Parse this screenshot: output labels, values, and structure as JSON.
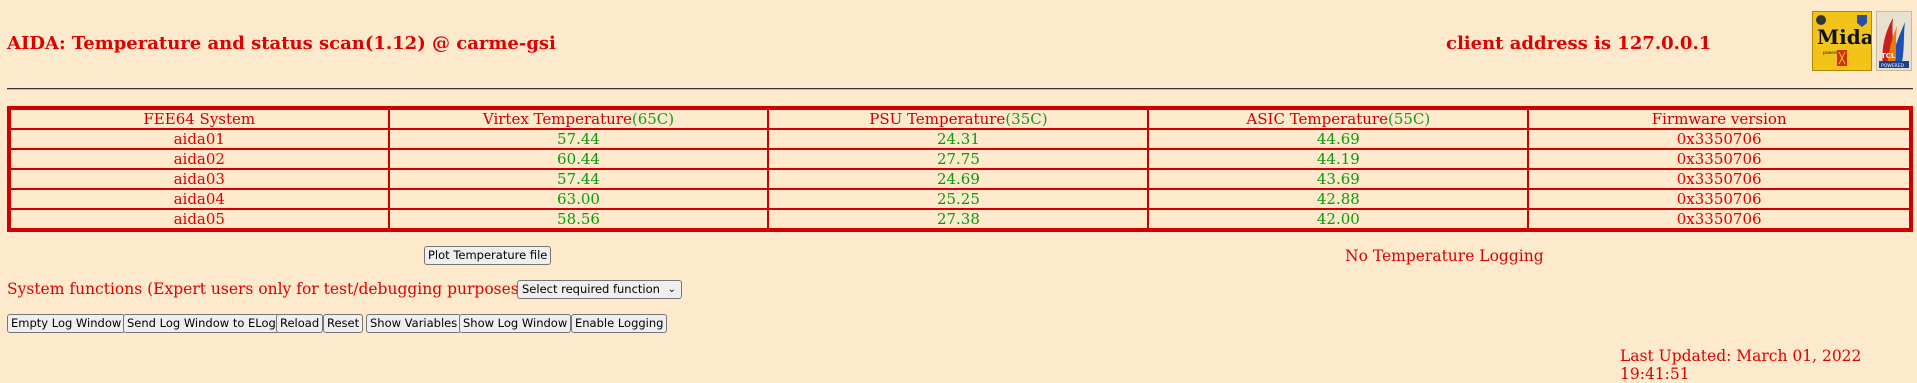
{
  "header": {
    "title": "AIDA: Temperature and status scan(1.12) @ carme-gsi",
    "client_address": "client address is 127.0.0.1",
    "logos": [
      "midas-logo",
      "tcl-powered-logo"
    ]
  },
  "table": {
    "columns": [
      {
        "label": "FEE64 System",
        "limit": ""
      },
      {
        "label": "Virtex Temperature",
        "limit": "(65C)"
      },
      {
        "label": "PSU Temperature",
        "limit": "(35C)"
      },
      {
        "label": "ASIC Temperature",
        "limit": "(55C)"
      },
      {
        "label": "Firmware version",
        "limit": ""
      }
    ],
    "rows": [
      {
        "system": "aida01",
        "virtex": "57.44",
        "psu": "24.31",
        "asic": "44.69",
        "firmware": "0x3350706"
      },
      {
        "system": "aida02",
        "virtex": "60.44",
        "psu": "27.75",
        "asic": "44.19",
        "firmware": "0x3350706"
      },
      {
        "system": "aida03",
        "virtex": "57.44",
        "psu": "24.69",
        "asic": "43.69",
        "firmware": "0x3350706"
      },
      {
        "system": "aida04",
        "virtex": "63.00",
        "psu": "25.25",
        "asic": "42.88",
        "firmware": "0x3350706"
      },
      {
        "system": "aida05",
        "virtex": "58.56",
        "psu": "27.38",
        "asic": "42.00",
        "firmware": "0x3350706"
      }
    ]
  },
  "plot_button": "Plot Temperature file",
  "logging_status": "No Temperature Logging",
  "system_functions": {
    "label": "System functions (Expert users only for test/debugging purposes!!!)",
    "select_value": "Select required function"
  },
  "buttons": {
    "empty_log": "Empty Log Window",
    "send_log": "Send Log Window to ELog",
    "reload": "Reload",
    "reset": "Reset",
    "show_variables": "Show Variables",
    "show_log": "Show Log Window",
    "enable_logging": "Enable Logging"
  },
  "last_updated": "Last Updated: March 01, 2022 19:41:51",
  "colors": {
    "background": "#fdeacd",
    "text_red": "#e00000",
    "value_green": "#0a9a0a"
  }
}
